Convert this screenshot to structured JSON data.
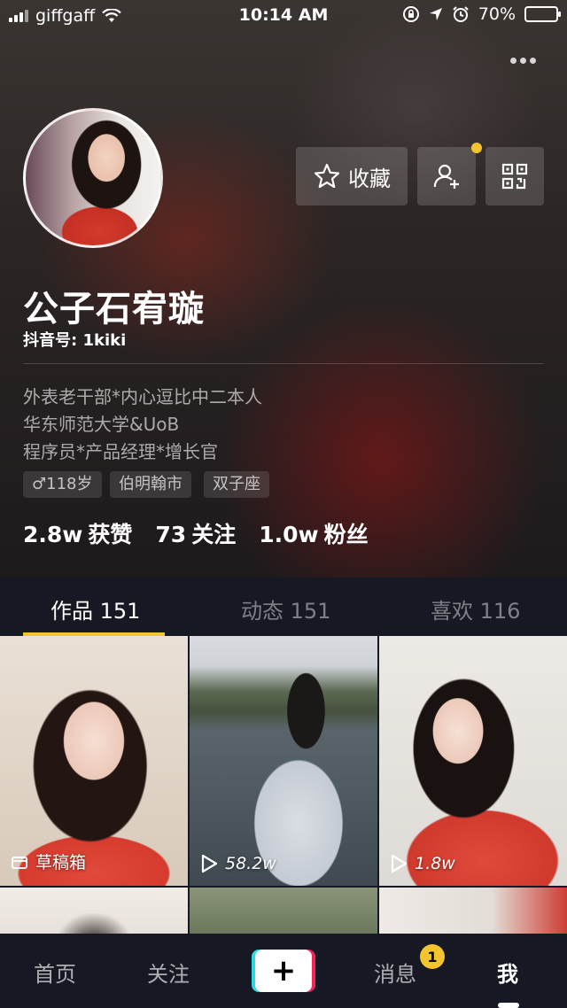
{
  "status_bar": {
    "carrier": "giffgaff",
    "time": "10:14 AM",
    "battery": "70%",
    "battery_level": 0.7,
    "icons": [
      "signal-icon",
      "wifi-icon",
      "orientation-lock-icon",
      "location-icon",
      "alarm-icon",
      "battery-icon"
    ]
  },
  "profile": {
    "name": "公子石宥璇",
    "douyin_id": "抖音号: 1kiki",
    "bio": [
      "外表老干部*内心逗比中二本人",
      "华东师范大学&UoB",
      "程序员*产品经理*增长官"
    ],
    "tags": {
      "age": "♂118岁",
      "city": "伯明翰市",
      "zodiac": "双子座"
    },
    "stats": {
      "likes_num": "2.8w",
      "likes_label": "获赞",
      "following_num": "73",
      "following_label": "关注",
      "fans_num": "1.0w",
      "fans_label": "粉丝"
    }
  },
  "header_actions": {
    "favorite_label": "收藏"
  },
  "tabs": {
    "works": "作品 151",
    "dynamic": "动态 151",
    "likes": "喜欢 116"
  },
  "grid": {
    "items": [
      {
        "caption": "草稿箱",
        "icon": "draft-box-icon"
      },
      {
        "caption": "58.2w",
        "icon": "play-icon"
      },
      {
        "caption": "1.8w",
        "icon": "play-icon"
      }
    ]
  },
  "bottom_nav": {
    "home": "首页",
    "follow": "关注",
    "add": "+",
    "messages": "消息",
    "messages_badge": "1",
    "me": "我"
  },
  "colors": {
    "accent": "#f2c530",
    "background": "#161823",
    "add_cyan": "#2fd8e0",
    "add_pink": "#f3245b"
  }
}
